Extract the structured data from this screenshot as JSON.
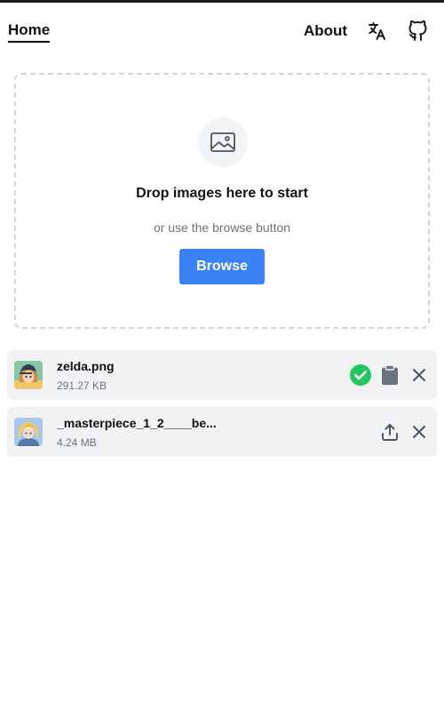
{
  "header": {
    "home_label": "Home",
    "about_label": "About",
    "icons": [
      "translate-icon",
      "github-icon"
    ]
  },
  "dropzone": {
    "icon": "image-icon",
    "title": "Drop images here to start",
    "subtitle": "or use the browse button",
    "browse_label": "Browse"
  },
  "files": [
    {
      "name": "zelda.png",
      "size": "291.27 KB",
      "status": "done",
      "icons": [
        "check-circle-icon",
        "clipboard-icon",
        "close-icon"
      ]
    },
    {
      "name": "_masterpiece_1_2____be...",
      "size": "4.24 MB",
      "status": "pending",
      "icons": [
        "upload-icon",
        "close-icon"
      ]
    }
  ],
  "colors": {
    "accent": "#3b82f6",
    "success": "#22c55e",
    "row_background": "#f1f2f4",
    "muted_text": "#6b7280"
  }
}
